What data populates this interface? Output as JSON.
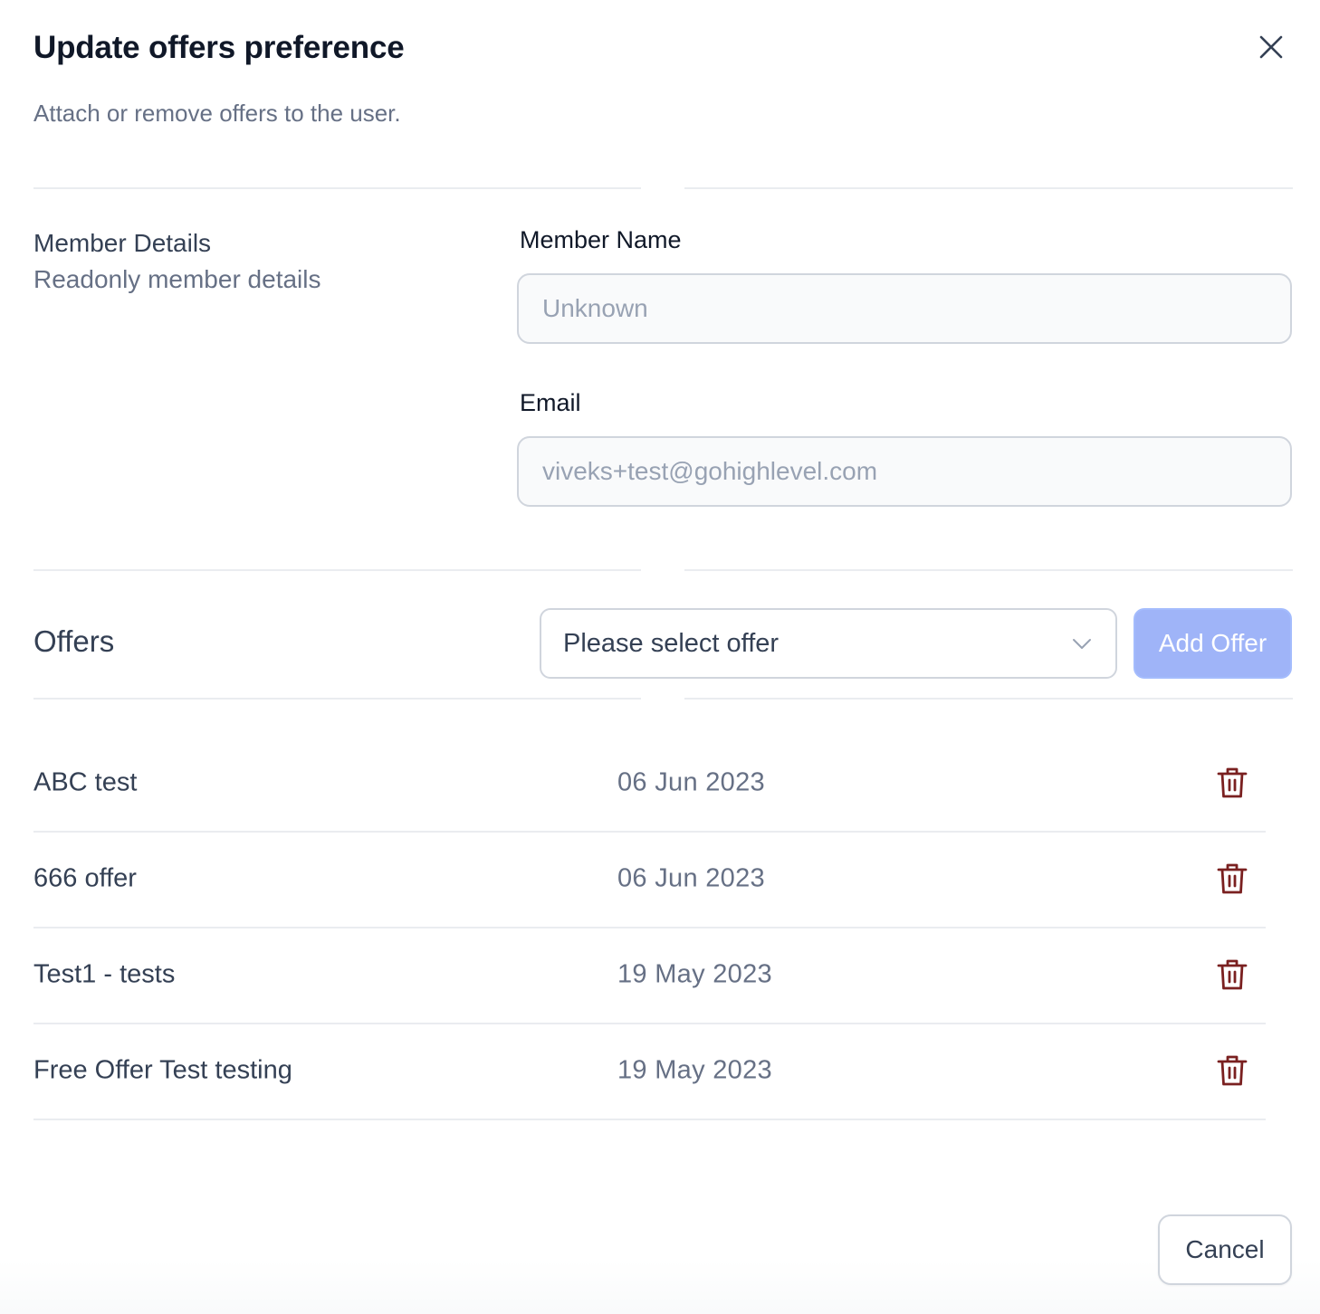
{
  "dialog": {
    "title": "Update offers preference",
    "subtitle": "Attach or remove offers to the user."
  },
  "member_details": {
    "title": "Member Details",
    "description": "Readonly member details",
    "name_label": "Member Name",
    "name_value": "Unknown",
    "email_label": "Email",
    "email_value": "viveks+test@gohighlevel.com"
  },
  "offers": {
    "title": "Offers",
    "select_placeholder": "Please select offer",
    "add_button": "Add Offer",
    "items": [
      {
        "name": "ABC test",
        "date": "06 Jun 2023"
      },
      {
        "name": "666 offer",
        "date": "06 Jun 2023"
      },
      {
        "name": "Test1 - tests",
        "date": "19 May 2023"
      },
      {
        "name": "Free Offer Test testing",
        "date": "19 May 2023"
      }
    ]
  },
  "footer": {
    "cancel_button": "Cancel"
  },
  "colors": {
    "delete_icon": "#7a2020",
    "primary_disabled": "#9fb4f8",
    "border": "#d0d5dd"
  },
  "icons": {
    "close": "close-icon",
    "chevron": "chevron-down-icon",
    "delete": "trash-icon"
  }
}
